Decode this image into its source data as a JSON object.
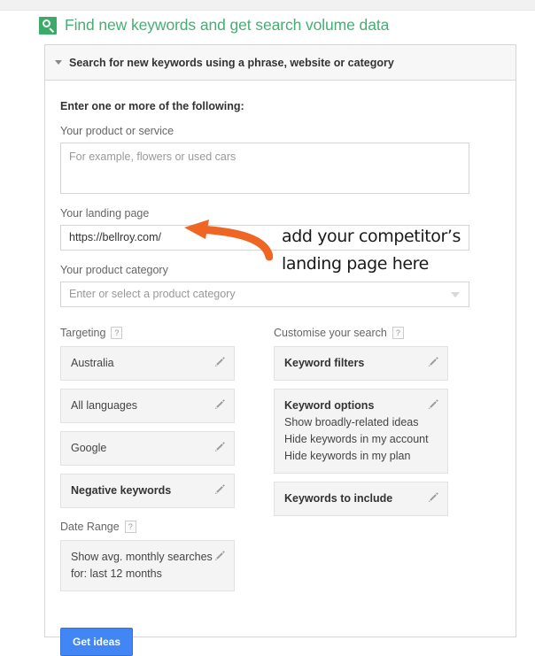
{
  "header": {
    "icon": "keyword-planner-search-icon",
    "title": "Find new keywords and get search volume data",
    "accent_green": "#43b072"
  },
  "panel": {
    "header_label": "Search for new keywords using a phrase, website or category",
    "collapse_icon": "caret-down-icon"
  },
  "form": {
    "section_title": "Enter one or more of the following:",
    "fields": [
      {
        "label": "Your product or service",
        "placeholder": "For example, flowers or used cars",
        "value": ""
      },
      {
        "label": "Your landing page",
        "placeholder": "",
        "value": "https://bellroy.com/"
      },
      {
        "label": "Your product category",
        "placeholder": "Enter or select a product category",
        "value": ""
      }
    ]
  },
  "targeting": {
    "heading": "Targeting",
    "help": "?",
    "items": [
      {
        "label": "Australia",
        "bold": false,
        "edit_icon": "pencil-icon"
      },
      {
        "label": "All languages",
        "bold": false,
        "edit_icon": "pencil-icon"
      },
      {
        "label": "Google",
        "bold": false,
        "edit_icon": "pencil-icon"
      },
      {
        "label": "Negative keywords",
        "bold": true,
        "edit_icon": "pencil-icon"
      }
    ]
  },
  "date_range": {
    "heading": "Date Range",
    "help": "?",
    "line1": "Show avg. monthly searches",
    "line2": "for: last 12 months",
    "edit_icon": "pencil-icon"
  },
  "customise": {
    "heading": "Customise your search",
    "help": "?",
    "keyword_filters": {
      "title": "Keyword filters",
      "edit_icon": "pencil-icon"
    },
    "keyword_options": {
      "title": "Keyword options",
      "lines": [
        "Show broadly-related ideas",
        "Hide keywords in my account",
        "Hide keywords in my plan"
      ],
      "edit_icon": "pencil-icon"
    },
    "keywords_to_include": {
      "title": "Keywords to include",
      "edit_icon": "pencil-icon"
    }
  },
  "actions": {
    "get_ideas_label": "Get ideas",
    "button_color": "#4285f4"
  },
  "annotation": {
    "line1": "add your competitor’s",
    "line2": "landing page here",
    "arrow_icon": "curved-arrow-icon",
    "color": "#ef6524"
  }
}
